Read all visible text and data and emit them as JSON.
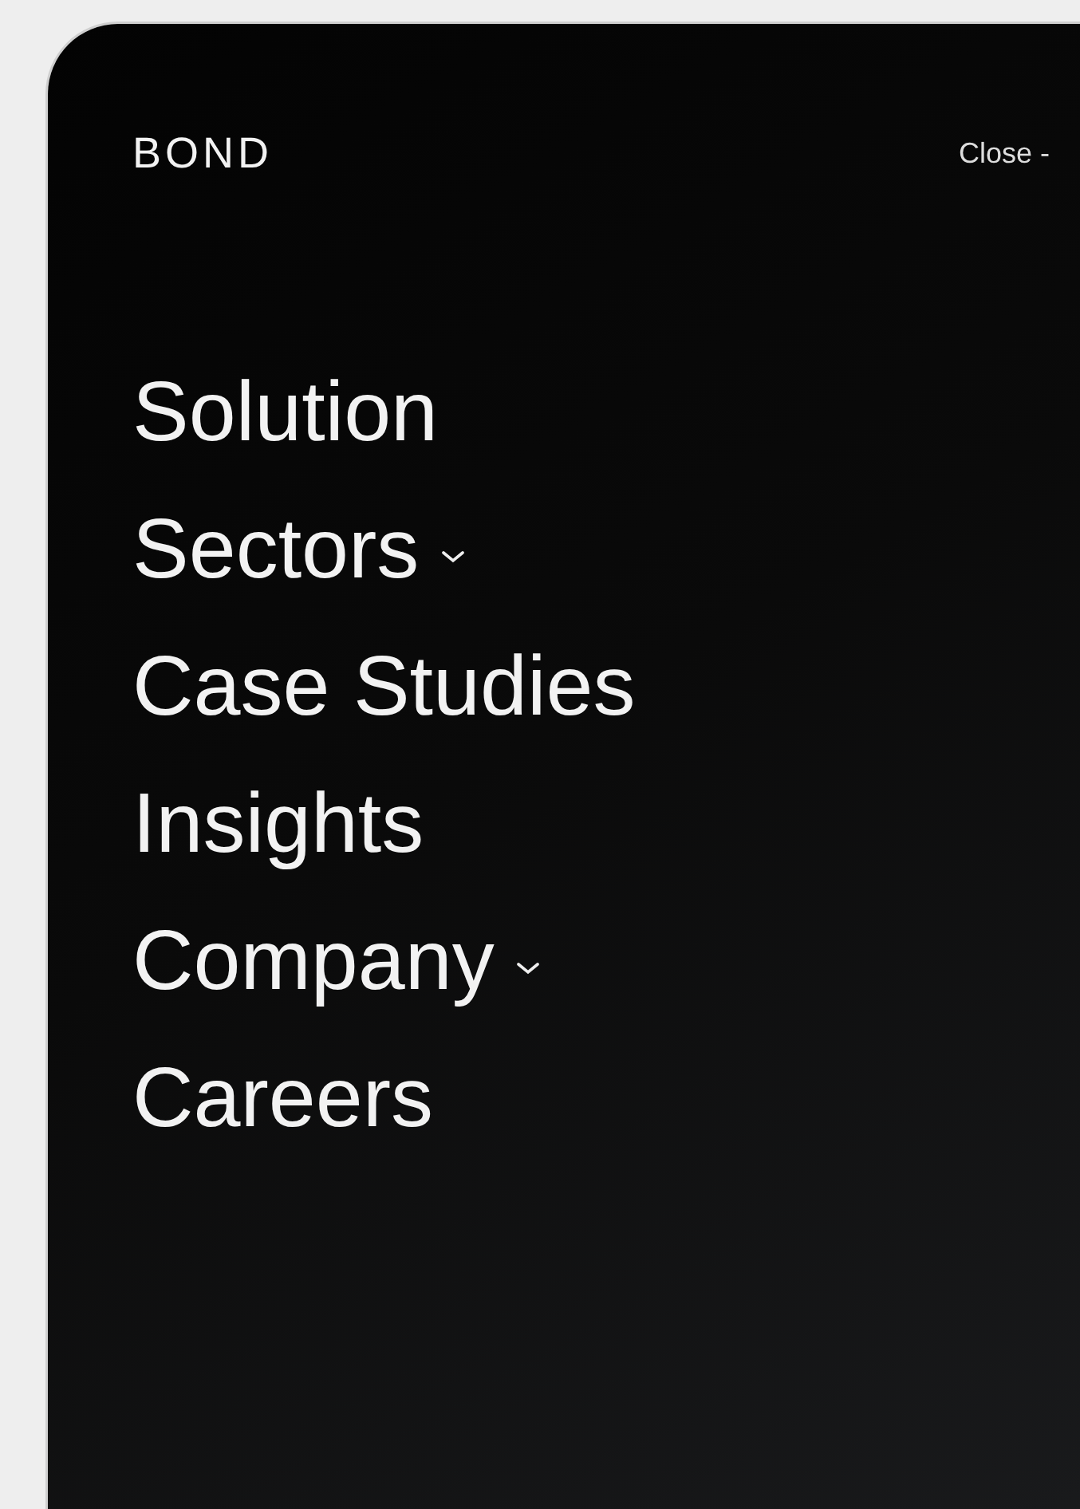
{
  "header": {
    "logo": "BOND",
    "close_label": "Close -"
  },
  "menu": [
    {
      "label": "Solution",
      "kind": "link"
    },
    {
      "label": "Sectors",
      "kind": "dropdown"
    },
    {
      "label": "Case Studies",
      "kind": "link"
    },
    {
      "label": "Insights",
      "kind": "link"
    },
    {
      "label": "Company",
      "kind": "dropdown"
    },
    {
      "label": "Careers",
      "kind": "link"
    }
  ]
}
